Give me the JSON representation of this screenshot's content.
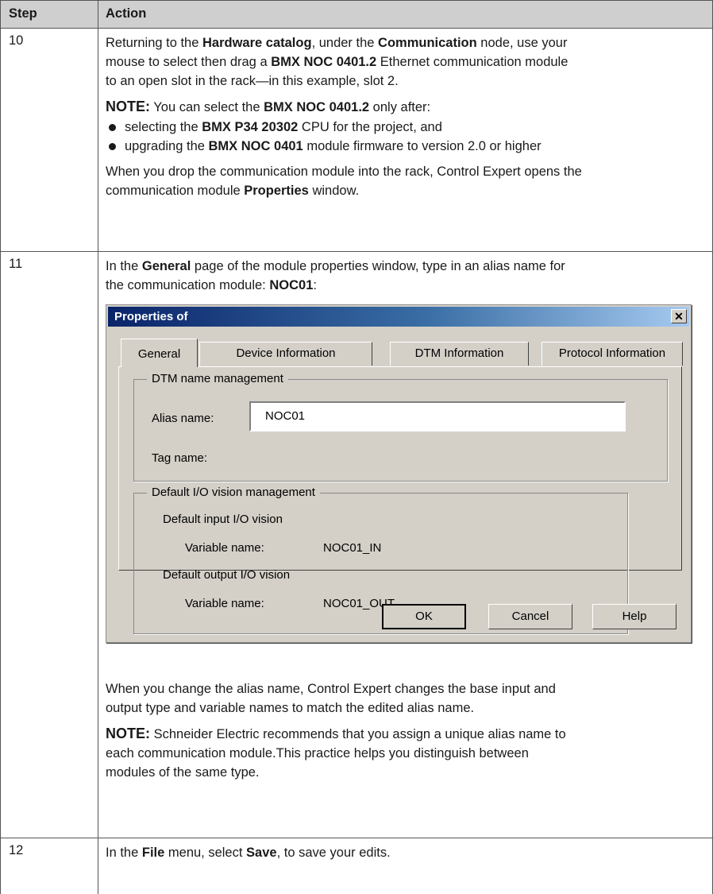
{
  "table": {
    "header": {
      "step": "Step",
      "action": "Action"
    },
    "row10": {
      "step": "10",
      "p1": [
        "Returning to the ",
        "Hardware catalog",
        ", under the ",
        "Communication",
        " node, use your",
        "mouse to select then drag a ",
        "BMX NOC 0401.2",
        " Ethernet communication module",
        "to an open slot in the rack—in this example, slot 2."
      ],
      "note": {
        "label": "NOTE:",
        "text1": " You can select the ",
        "bold1": "BMX NOC 0401.2",
        "text2": " only after:",
        "bullet1": {
          "pre": "selecting the ",
          "bold": "BMX P34 20302",
          "post": " CPU for the project, and"
        },
        "bullet2": {
          "pre": "upgrading the ",
          "bold": "BMX NOC 0401",
          "post": " module firmware to version 2.0 or higher"
        }
      },
      "p3": {
        "line1": "When you drop the communication module into the rack, Control Expert opens the",
        "line2pre": "communication module ",
        "line2bold": "Properties",
        "line2post": " window."
      }
    },
    "row11": {
      "step": "11",
      "intro": {
        "pre": "In the ",
        "bold1": "General",
        "mid": " page of the module properties window, type in an alias name for",
        "line2pre": "the communication module: ",
        "bold2": "NOC01",
        "line2post": ":"
      },
      "dialog": {
        "title": "Properties of",
        "close_glyph": "✕",
        "tabs": [
          "General",
          "Device Information",
          "DTM Information",
          "Protocol Information"
        ],
        "dtm_group": {
          "title": "DTM name management",
          "alias_label": "Alias name:",
          "alias_value": "NOC01",
          "tag_label": "Tag name:"
        },
        "io_group": {
          "title": "Default I/O vision management",
          "input_heading": "Default input I/O vision",
          "input_var_label": "Variable name:",
          "input_var_value": "NOC01_IN",
          "output_heading": "Default output I/O vision",
          "output_var_label": "Variable name:",
          "output_var_value": "NOC01_OUT"
        },
        "buttons": {
          "ok": "OK",
          "cancel": "Cancel",
          "help": "Help"
        }
      },
      "after": {
        "line1": "When you change the alias name, Control Expert changes the base input and",
        "line2": "output type and variable names to match the edited alias name."
      },
      "note2": {
        "label": "NOTE:",
        "line1": " Schneider Electric recommends that you assign a unique alias name to",
        "line2": "each communication module.This practice helps you distinguish between",
        "line3": "modules of the same type."
      }
    },
    "row12": {
      "step": "12",
      "pre": "In the ",
      "bold1": "File",
      "mid": " menu, select ",
      "bold2": "Save",
      "post": ", to save your edits."
    }
  }
}
